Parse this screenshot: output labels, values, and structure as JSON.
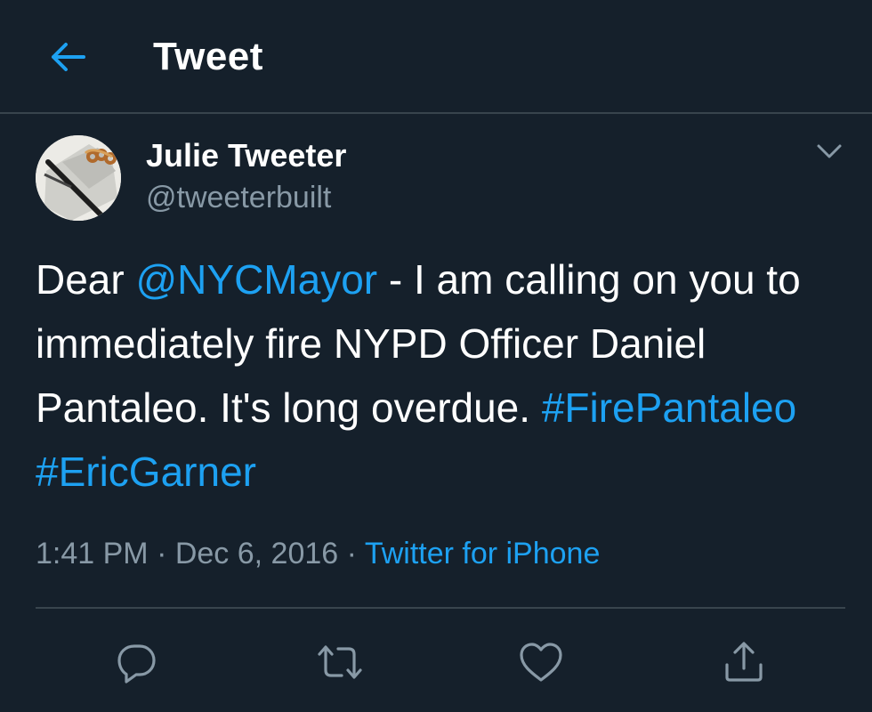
{
  "header": {
    "title": "Tweet",
    "back_icon": "arrow-left-icon"
  },
  "author": {
    "name": "Julie Tweeter",
    "handle": "@tweeterbuilt"
  },
  "tweet": {
    "segments": [
      {
        "text": "Dear ",
        "type": "text"
      },
      {
        "text": "@NYCMayor",
        "type": "mention"
      },
      {
        "text": " - I am calling on you to immediately fire NYPD Officer Daniel Pantaleo. It's long overdue. ",
        "type": "text"
      },
      {
        "text": "#FirePantaleo",
        "type": "hashtag"
      },
      {
        "text": " ",
        "type": "text"
      },
      {
        "text": "#EricGarner",
        "type": "hashtag"
      }
    ]
  },
  "meta": {
    "time": "1:41 PM",
    "separator": " · ",
    "date": "Dec 6, 2016",
    "source": "Twitter for iPhone"
  },
  "actions": {
    "reply_icon": "reply-icon",
    "retweet_icon": "retweet-icon",
    "like_icon": "heart-icon",
    "share_icon": "share-icon"
  },
  "colors": {
    "background": "#15202b",
    "accent": "#1da1f2",
    "secondary_text": "#8899a6",
    "divider": "#38444d"
  }
}
